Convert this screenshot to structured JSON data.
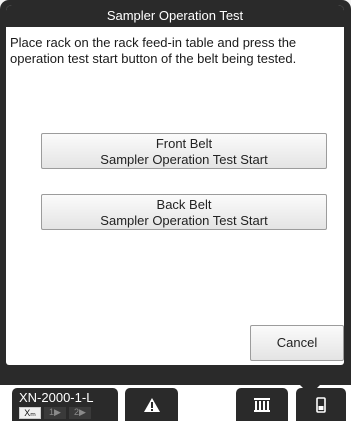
{
  "dialog": {
    "title": "Sampler Operation Test",
    "message": "Place rack on the rack feed-in table and press the operation test start button of the belt being tested.",
    "front_button": {
      "line1": "Front Belt",
      "line2": "Sampler Operation Test Start"
    },
    "back_button": {
      "line1": "Back Belt",
      "line2": "Sampler Operation Test Start"
    },
    "cancel_label": "Cancel"
  },
  "footer": {
    "model_name": "XN-2000-1-L",
    "mode_labels": [
      "Xₘ",
      "1▶",
      "2▶"
    ],
    "tabs": [
      {
        "icon": "warning-icon"
      },
      {
        "icon": "rack-icon"
      },
      {
        "icon": "device-icon"
      }
    ]
  },
  "colors": {
    "bar": "#2a2a2a",
    "dialog_bg": "#ffffff",
    "button_border": "#9c9c9c"
  }
}
